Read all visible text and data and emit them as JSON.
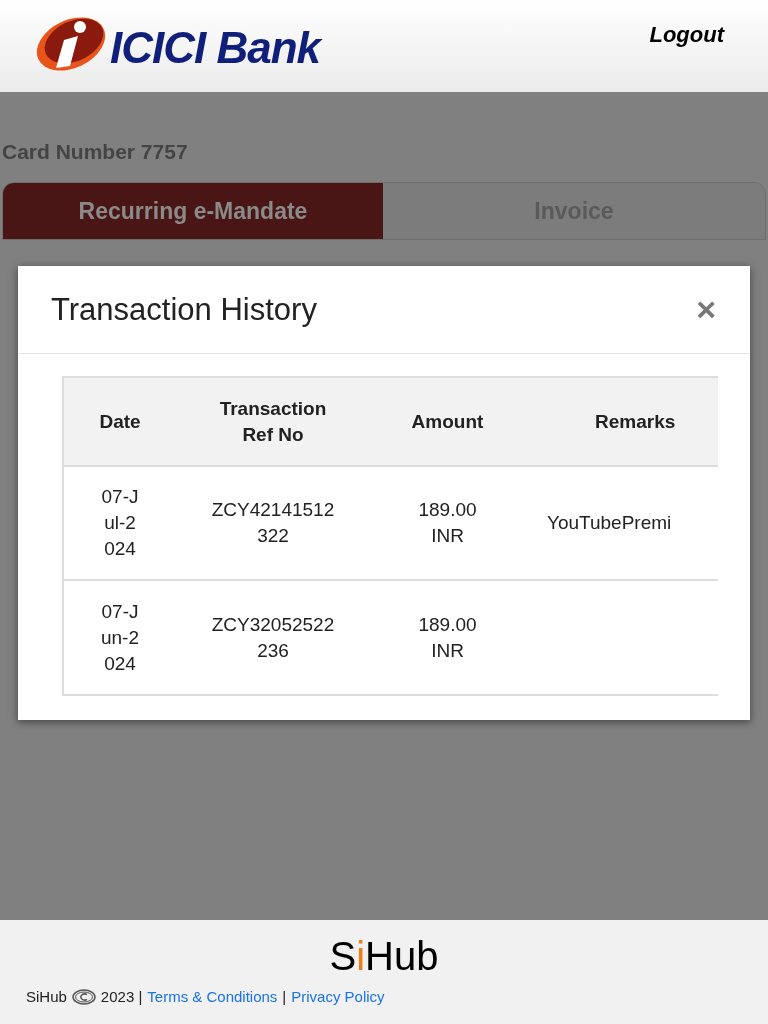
{
  "header": {
    "logo_text": "ICICI Bank",
    "logout": "Logout"
  },
  "page": {
    "card_number": "Card Number 7757",
    "tabs": [
      {
        "label": "Recurring e-Mandate",
        "selected": true
      },
      {
        "label": "Invoice",
        "selected": false
      }
    ]
  },
  "modal": {
    "title": "Transaction History",
    "close": "×",
    "table": {
      "columns": [
        "Date",
        "Transaction Ref No",
        "Amount",
        "Remarks"
      ],
      "rows": [
        [
          "07-Jul-2024",
          "ZCY42141512322",
          "189.00 INR",
          "YouTubePremi"
        ],
        [
          "07-Jun-2024",
          "ZCY32052522236",
          "189.00 INR",
          ""
        ]
      ]
    }
  },
  "footer": {
    "brand_start": "S",
    "brand_accent": "i",
    "brand_end": "Hub",
    "copyright_name": "SiHub",
    "year": "2023 |",
    "links": [
      "Terms & Conditions",
      "Privacy Policy"
    ],
    "separator": "|"
  }
}
